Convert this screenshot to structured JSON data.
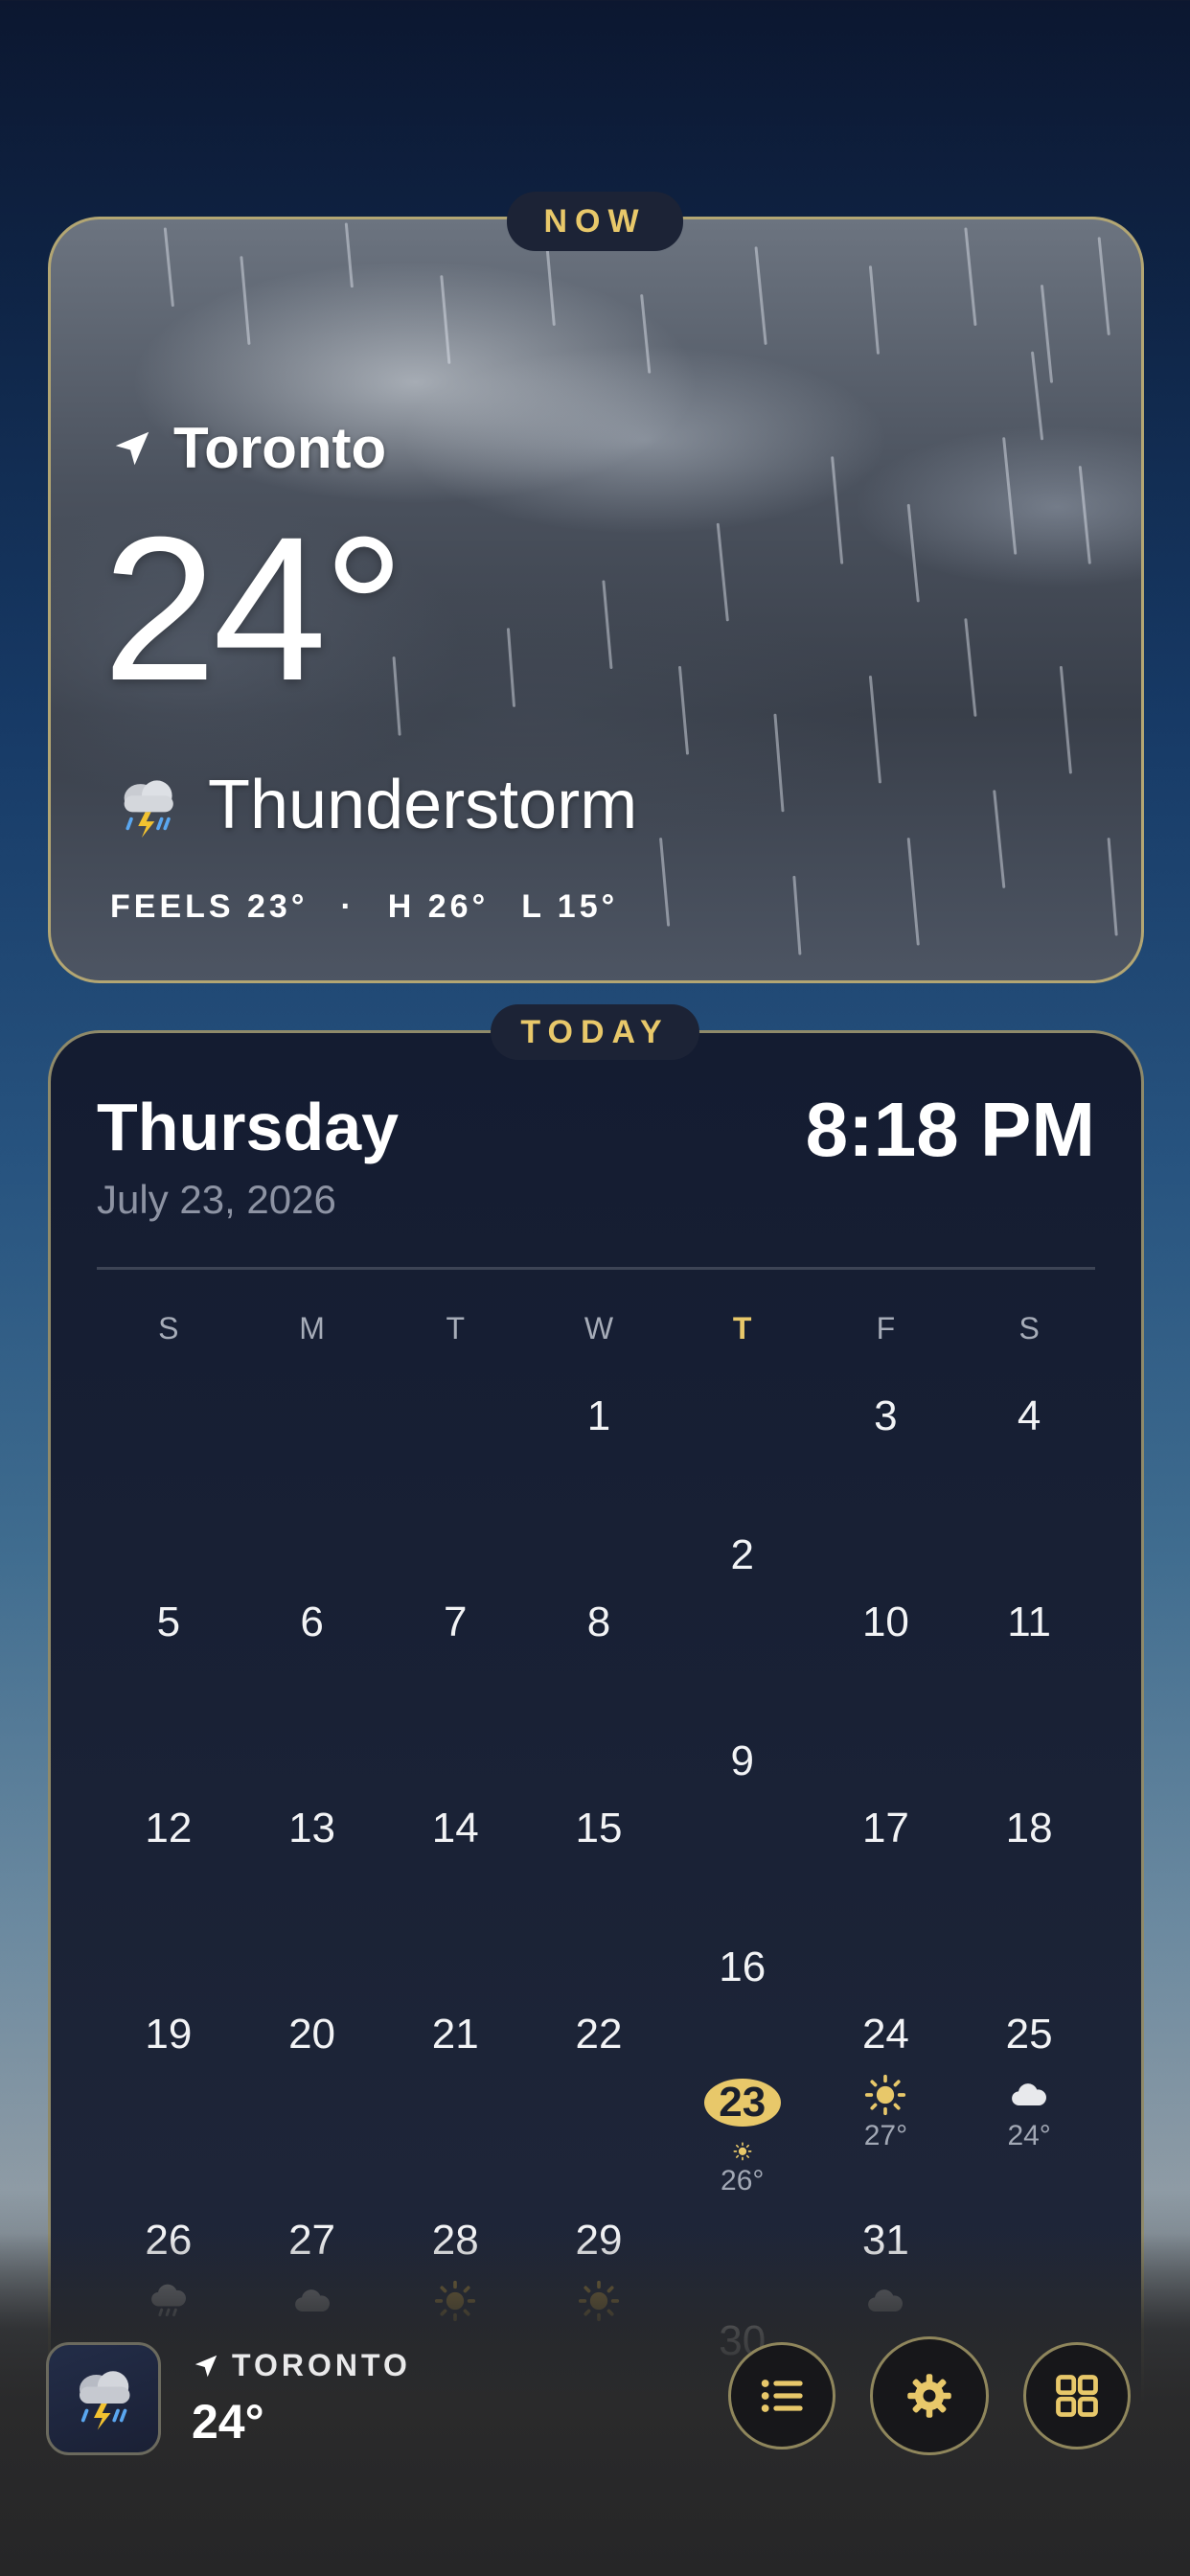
{
  "now": {
    "pill": "NOW",
    "city": "Toronto",
    "temperature": "24°",
    "condition": "Thunderstorm",
    "feels": "FEELS 23°",
    "separator": "·",
    "high": "H 26°",
    "low": "L 15°",
    "condition_icon": "thunderstorm-icon"
  },
  "today": {
    "pill": "TODAY",
    "day_name": "Thursday",
    "date": "July 23, 2026",
    "time": "8:18 PM",
    "weekdays": [
      "S",
      "M",
      "T",
      "W",
      "T",
      "F",
      "S"
    ],
    "highlight_color": "#e8c86a",
    "weeks": [
      [
        {
          "d": ""
        },
        {
          "d": ""
        },
        {
          "d": ""
        },
        {
          "d": "1"
        },
        {
          "d": "2"
        },
        {
          "d": "3"
        },
        {
          "d": "4"
        }
      ],
      [
        {
          "d": "5"
        },
        {
          "d": "6"
        },
        {
          "d": "7"
        },
        {
          "d": "8"
        },
        {
          "d": "9"
        },
        {
          "d": "10"
        },
        {
          "d": "11"
        }
      ],
      [
        {
          "d": "12"
        },
        {
          "d": "13"
        },
        {
          "d": "14"
        },
        {
          "d": "15"
        },
        {
          "d": "16"
        },
        {
          "d": "17"
        },
        {
          "d": "18"
        }
      ],
      [
        {
          "d": "19"
        },
        {
          "d": "20"
        },
        {
          "d": "21"
        },
        {
          "d": "22"
        },
        {
          "d": "23",
          "today": true,
          "icon": "sun",
          "temp": "26°"
        },
        {
          "d": "24",
          "icon": "sun",
          "temp": "27°"
        },
        {
          "d": "25",
          "icon": "cloud",
          "temp": "24°"
        }
      ],
      [
        {
          "d": "26",
          "icon": "rain"
        },
        {
          "d": "27",
          "icon": "cloud"
        },
        {
          "d": "28",
          "icon": "sun-dim"
        },
        {
          "d": "29",
          "icon": "sun-dim"
        },
        {
          "d": "30",
          "icon": "rain"
        },
        {
          "d": "31",
          "icon": "cloud"
        },
        {
          "d": ""
        }
      ]
    ]
  },
  "dock": {
    "location": "TORONTO",
    "temperature": "24°",
    "buttons": [
      "list-icon",
      "gear-icon",
      "grid-icon"
    ]
  }
}
